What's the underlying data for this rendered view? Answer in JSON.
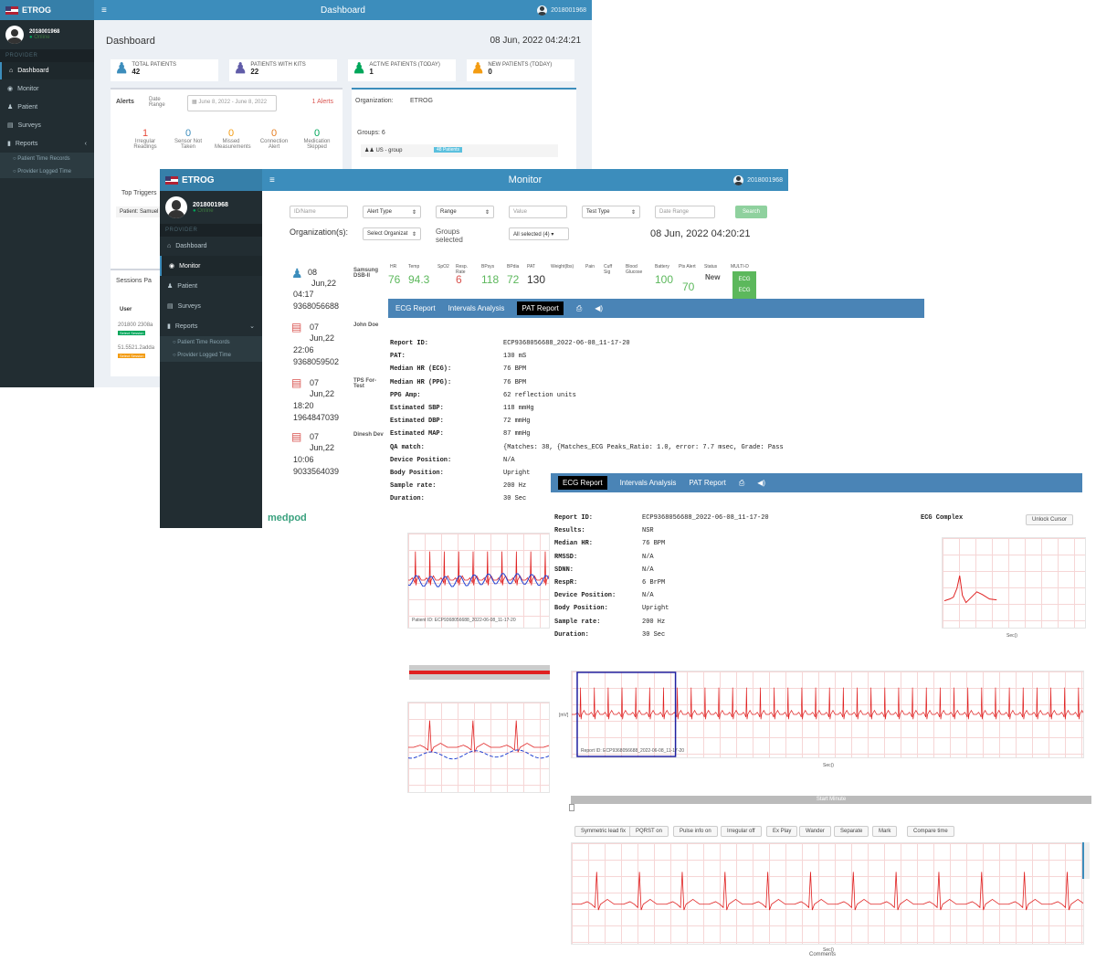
{
  "brand": "ETROG",
  "user_id": "2018001968",
  "online_label": "Online",
  "provider_header": "PROVIDER",
  "sidebar": {
    "items": [
      "Dashboard",
      "Monitor",
      "Patient",
      "Surveys",
      "Reports"
    ],
    "sub_items": [
      "Patient Time Records",
      "Provider Logged Time"
    ]
  },
  "dashboard": {
    "topbar_title": "Dashboard",
    "page_title": "Dashboard",
    "datetime": "08 Jun, 2022 04:24:21",
    "kpis": [
      {
        "label": "TOTAL PATIENTS",
        "value": "42",
        "color": "#3c8dbc"
      },
      {
        "label": "PATIENTS WITH KITS",
        "value": "22",
        "color": "#605ca8"
      },
      {
        "label": "ACTIVE PATIENTS (TODAY)",
        "value": "1",
        "color": "#00a65a"
      },
      {
        "label": "NEW PATIENTS (TODAY)",
        "value": "0",
        "color": "#f39c12"
      }
    ],
    "alerts_label": "Alerts",
    "date_range_label": "Date Range",
    "date_range_value": "June 8, 2022 - June 8, 2022",
    "alerts_count": "1 Alerts",
    "alert_stats": [
      {
        "value": "1",
        "label": "Irregular Readings",
        "color": "#e74c3c"
      },
      {
        "value": "0",
        "label": "Sensor Not Taken",
        "color": "#3c8dbc"
      },
      {
        "value": "0",
        "label": "Missed Measurements",
        "color": "#f39c12"
      },
      {
        "value": "0",
        "label": "Connection Alert",
        "color": "#e67e22"
      },
      {
        "value": "0",
        "label": "Medication Skipped",
        "color": "#00a65a"
      }
    ],
    "top_triggers_label": "Top Triggers",
    "patient_label": "Patient: Samuel",
    "organization_label": "Organization:",
    "organization_value": "ETROG",
    "groups_label": "Groups: 6",
    "group_item": "US - group",
    "group_badge": "48 Patients",
    "sessions_label": "Sessions Pa",
    "user_col": "User",
    "session_users": [
      "201800 2308a",
      "51.5521.2adda"
    ],
    "session_badges": [
      "Select Session",
      "Select Session"
    ]
  },
  "monitor": {
    "topbar_title": "Monitor",
    "filters": {
      "id_placeholder": "ID/Name",
      "alert_type": "Alert Type",
      "range": "Range",
      "value": "Value",
      "test_type": "Test Type",
      "date_range": "Date Range",
      "search": "Search"
    },
    "organizations_label": "Organization(s):",
    "select_org": "Select Organizat",
    "groups_selected": "Groups selected",
    "all_selected": "All selected (4)",
    "datetime": "08 Jun, 2022 04:20:21",
    "vital_headers": [
      "HR",
      "Temp",
      "SpO2",
      "Resp. Rate",
      "BPsys",
      "BPdia",
      "PAT",
      "Weight(lbs)",
      "Pain",
      "Cuff Sig",
      "Blood Glucose",
      "Battery",
      "Pts Alert",
      "Status",
      "MULTI-D"
    ],
    "vitals": [
      {
        "value": "76",
        "color": "#5cb85c"
      },
      {
        "value": "94.3",
        "color": "#5cb85c"
      },
      {
        "value": "6",
        "color": "#d9534f"
      },
      {
        "value": "118",
        "color": "#5cb85c"
      },
      {
        "value": "72",
        "color": "#5cb85c"
      },
      {
        "value": "130",
        "color": "#333"
      }
    ],
    "battery": "100",
    "alert_val": "70",
    "status": "New",
    "ecg_btn": "ECG",
    "rows": [
      {
        "date": "08",
        "month": "Jun,22",
        "time": "04:17",
        "phone": "9368056688",
        "name": "Samsung DSB-II"
      },
      {
        "date": "07",
        "month": "Jun,22",
        "time": "22:06",
        "phone": "9368059502",
        "name": "John Doe"
      },
      {
        "date": "07",
        "month": "Jun,22",
        "time": "18:20",
        "phone": "1964847039",
        "name": "TPS For-Test"
      },
      {
        "date": "07",
        "month": "Jun,22",
        "time": "10:06",
        "phone": "9033564039",
        "name": "Dinesh Dev"
      }
    ],
    "footer_logo": "medpod"
  },
  "pat_report": {
    "tabs": [
      "ECG Report",
      "Intervals Analysis",
      "PAT Report"
    ],
    "active_tab": 2,
    "fields": [
      {
        "k": "Report ID:",
        "v": "ECP9368056688_2022-06-08_11-17-20"
      },
      {
        "k": "PAT:",
        "v": "130 mS"
      },
      {
        "k": "Median HR (ECG):",
        "v": "76 BPM"
      },
      {
        "k": "Median HR (PPG):",
        "v": "76 BPM"
      },
      {
        "k": "PPG Amp:",
        "v": "62 reflection units"
      },
      {
        "k": "Estimated SBP:",
        "v": "118 mmHg"
      },
      {
        "k": "Estimated DBP:",
        "v": "72 mmHg"
      },
      {
        "k": "Estimated MAP:",
        "v": "87 mmHg"
      },
      {
        "k": "QA match:",
        "v": "{Matches: 38, {Matches_ECG Peaks_Ratio: 1.0, error: 7.7 msec, Grade: Pass"
      },
      {
        "k": "Device Position:",
        "v": "N/A"
      },
      {
        "k": "Body Position:",
        "v": "Upright"
      },
      {
        "k": "Sample rate:",
        "v": "200 Hz"
      },
      {
        "k": "Duration:",
        "v": "30 Sec"
      }
    ]
  },
  "ecg_report": {
    "tabs": [
      "ECG Report",
      "Intervals Analysis",
      "PAT Report"
    ],
    "active_tab": 0,
    "fields": [
      {
        "k": "Report ID:",
        "v": "ECP9368056688_2022-06-08_11-17-20"
      },
      {
        "k": "Results:",
        "v": "NSR"
      },
      {
        "k": "Median HR:",
        "v": "76 BPM"
      },
      {
        "k": "RMSSD:",
        "v": "N/A"
      },
      {
        "k": "SDNN:",
        "v": "N/A"
      },
      {
        "k": "RespR:",
        "v": "6 BrPM"
      },
      {
        "k": "Device Position:",
        "v": "N/A"
      },
      {
        "k": "Body Position:",
        "v": "Upright"
      },
      {
        "k": "Sample rate:",
        "v": "200 Hz"
      },
      {
        "k": "Duration:",
        "v": "30 Sec"
      }
    ],
    "ecg_complex_label": "ECG Complex",
    "unlock_btn": "Unlock Cursor",
    "xlabel": "Sec()",
    "ylabel": "[mV]",
    "start_minute": "Start Minute",
    "chips": [
      "Symmetric lead fix",
      "PQRST on",
      "Pulse info on",
      "Irregular off",
      "Ex Play",
      "Wander",
      "Separate",
      "Mark",
      "Compare time"
    ],
    "comments": "Comments",
    "strip_caption_1": "Report ID: ECP9368056688_2022-06-08_11-17-20",
    "strip_caption_2": "Patient ID: ECP9368056688_2022-06-08_11-17-20"
  },
  "colors": {
    "header_blue": "#3c8dbc",
    "sidebar_dark": "#222d32",
    "ecg_red": "#e02020",
    "ppg_blue": "#1f3fd0"
  }
}
